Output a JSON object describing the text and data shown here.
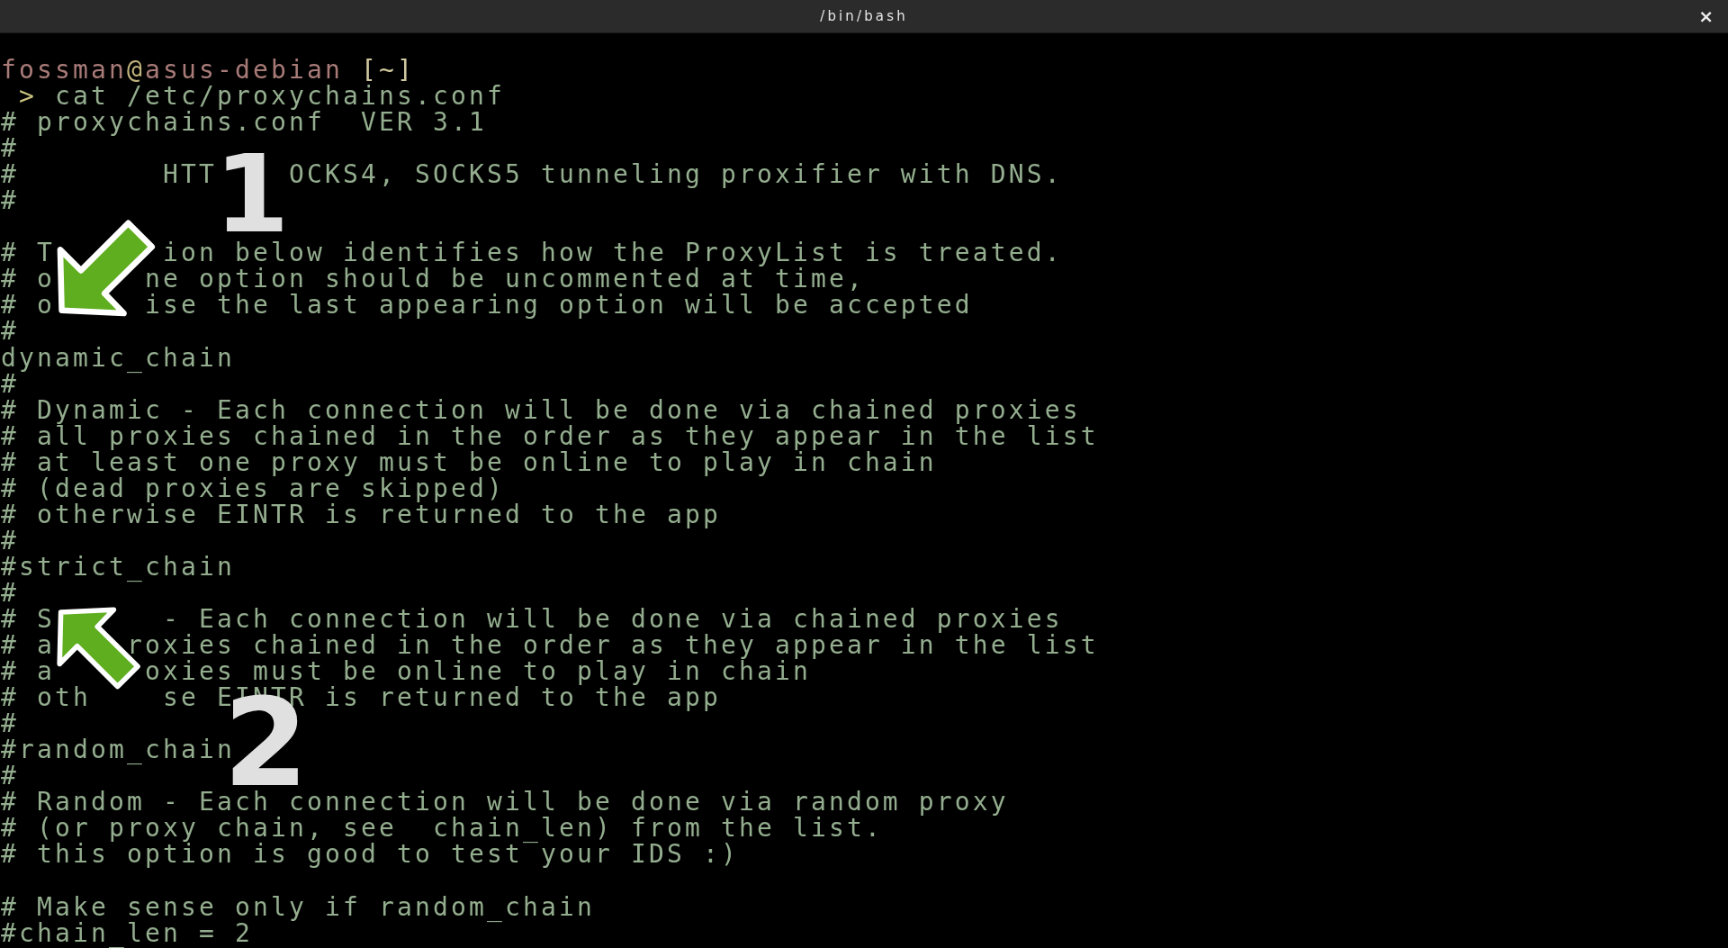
{
  "window": {
    "title": "/bin/bash",
    "close": "×"
  },
  "terminal": {
    "lines": [
      {
        "kind": "prompt",
        "user": "fossman",
        "at": "@",
        "host": "asus-debian",
        "cwd": "[~]"
      },
      {
        "kind": "command",
        "symbol": ">",
        "text": "cat /etc/proxychains.conf"
      },
      {
        "kind": "output",
        "text": "# proxychains.conf  VER 3.1"
      },
      {
        "kind": "output",
        "text": "#"
      },
      {
        "kind": "output",
        "text": "#        HTT    OCKS4, SOCKS5 tunneling proxifier with DNS."
      },
      {
        "kind": "output",
        "text": "#"
      },
      {
        "kind": "blank"
      },
      {
        "kind": "output",
        "text": "# T      ion below identifies how the ProxyList is treated."
      },
      {
        "kind": "output",
        "text": "# o     ne option should be uncommented at time,"
      },
      {
        "kind": "output",
        "text": "# o     ise the last appearing option will be accepted"
      },
      {
        "kind": "output",
        "text": "#"
      },
      {
        "kind": "output",
        "text": "dynamic_chain"
      },
      {
        "kind": "output",
        "text": "#"
      },
      {
        "kind": "output",
        "text": "# Dynamic - Each connection will be done via chained proxies"
      },
      {
        "kind": "output",
        "text": "# all proxies chained in the order as they appear in the list"
      },
      {
        "kind": "output",
        "text": "# at least one proxy must be online to play in chain"
      },
      {
        "kind": "output",
        "text": "# (dead proxies are skipped)"
      },
      {
        "kind": "output",
        "text": "# otherwise EINTR is returned to the app"
      },
      {
        "kind": "output",
        "text": "#"
      },
      {
        "kind": "output",
        "text": "#strict_chain"
      },
      {
        "kind": "output",
        "text": "#"
      },
      {
        "kind": "output",
        "text": "# S      - Each connection will be done via chained proxies"
      },
      {
        "kind": "output",
        "text": "# a    roxies chained in the order as they appear in the list"
      },
      {
        "kind": "output",
        "text": "# a     oxies must be online to play in chain"
      },
      {
        "kind": "output",
        "text": "# oth    se EINTR is returned to the app"
      },
      {
        "kind": "output",
        "text": "#"
      },
      {
        "kind": "output",
        "text": "#random_chain"
      },
      {
        "kind": "output",
        "text": "#"
      },
      {
        "kind": "output",
        "text": "# Random - Each connection will be done via random proxy"
      },
      {
        "kind": "output",
        "text": "# (or proxy chain, see  chain_len) from the list."
      },
      {
        "kind": "output",
        "text": "# this option is good to test your IDS :)"
      },
      {
        "kind": "blank"
      },
      {
        "kind": "output",
        "text": "# Make sense only if random_chain"
      },
      {
        "kind": "output",
        "text": "#chain_len = 2"
      }
    ]
  },
  "annotations": [
    {
      "kind": "arrow-down-left"
    },
    {
      "kind": "number",
      "text": "1"
    },
    {
      "kind": "arrow-up-left"
    },
    {
      "kind": "number",
      "text": "2"
    }
  ]
}
